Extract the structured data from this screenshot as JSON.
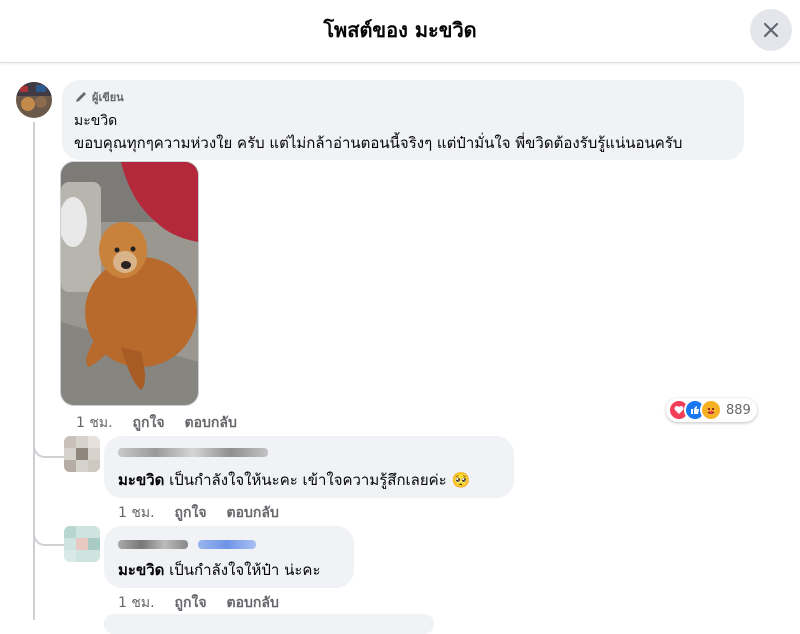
{
  "header": {
    "title": "โพสต์ของ มะขวิด"
  },
  "post_comment": {
    "badge_label": "ผู้เขียน",
    "author": "มะขวิด",
    "text": "ขอบคุณทุกๆความห่วงใย ครับ แต่ไม่กล้าอ่านตอนนี้จริงๆ แต่ป๋ามั่นใจ พี่ขวิดต้องรับรู้แน่นอนครับ",
    "time": "1 ชม.",
    "like_label": "ถูกใจ",
    "reply_label": "ตอบกลับ",
    "reaction_count": "889"
  },
  "replies": [
    {
      "mention": "มะขวิด",
      "text": " เป็นกำลังใจให้นะคะ เข้าใจความรู้สึกเลยค่ะ 🥺",
      "time": "1 ชม.",
      "like_label": "ถูกใจ",
      "reply_label": "ตอบกลับ"
    },
    {
      "mention": "มะขวิด",
      "text": " เป็นกำลังใจให้ป๋า น่ะคะ",
      "time": "1 ชม.",
      "like_label": "ถูกใจ",
      "reply_label": "ตอบกลับ"
    }
  ],
  "icons": {
    "close": "close-icon",
    "pencil": "pencil-icon",
    "reactions": [
      "love-icon",
      "like-icon",
      "care-icon"
    ]
  },
  "colors": {
    "love": "#f33e58",
    "like": "#1877f2",
    "care": "#f7b125"
  }
}
